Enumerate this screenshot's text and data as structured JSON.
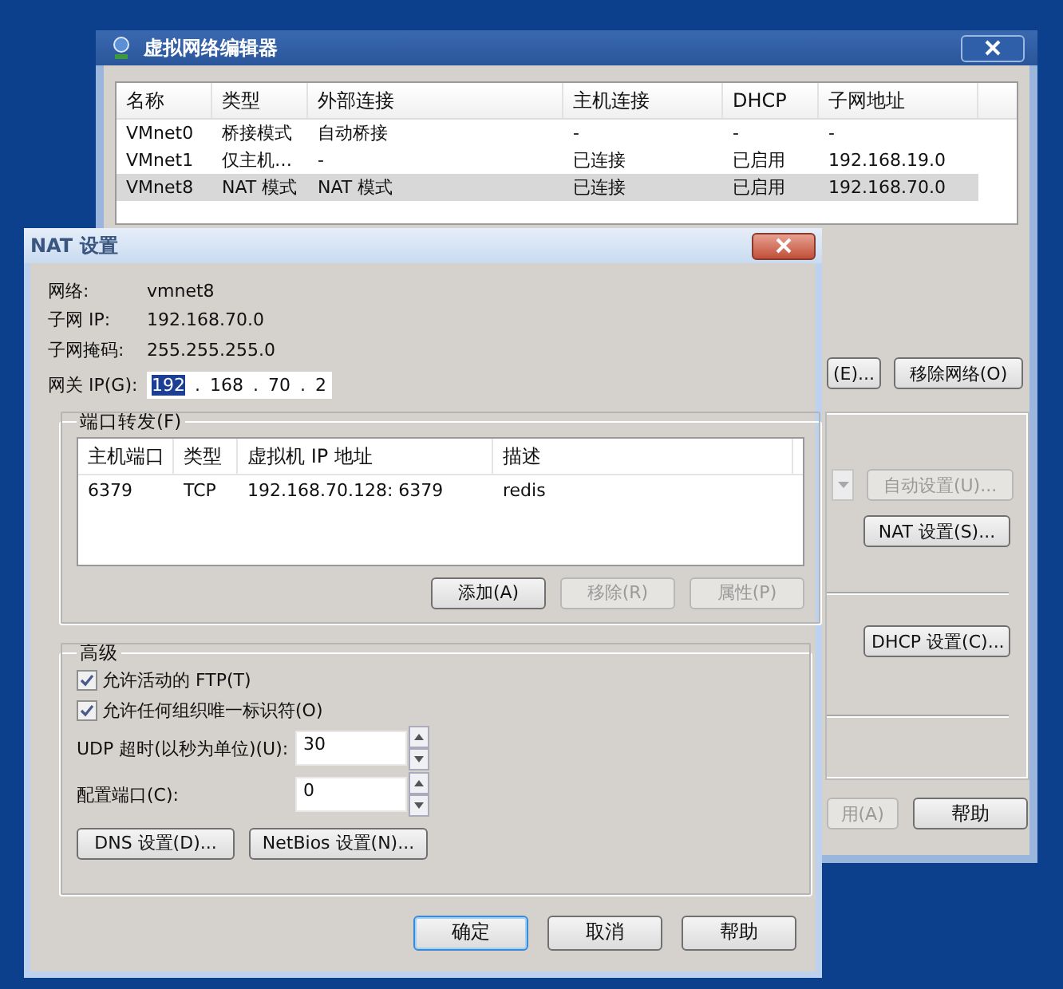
{
  "network_editor": {
    "title": "虚拟网络编辑器",
    "columns": [
      "名称",
      "类型",
      "外部连接",
      "主机连接",
      "DHCP",
      "子网地址"
    ],
    "rows": [
      {
        "cells": [
          "VMnet0",
          "桥接模式",
          "自动桥接",
          "-",
          "-",
          "-"
        ],
        "selected": false
      },
      {
        "cells": [
          "VMnet1",
          "仅主机…",
          "-",
          "已连接",
          "已启用",
          "192.168.19.0"
        ],
        "selected": false
      },
      {
        "cells": [
          "VMnet8",
          "NAT 模式",
          "NAT 模式",
          "已连接",
          "已启用",
          "192.168.70.0"
        ],
        "selected": true
      }
    ],
    "top_buttons": [
      {
        "label": "(E)...",
        "disabled": false
      },
      {
        "label": "移除网络(O)",
        "disabled": false
      }
    ],
    "dropdown": {
      "disabled": true
    },
    "auto_button": {
      "label": "自动设置(U)...",
      "disabled": true
    },
    "nat_button": {
      "label": "NAT 设置(S)...",
      "disabled": false
    },
    "dhcp_button": {
      "label": "DHCP 设置(C)...",
      "disabled": false
    },
    "bottom_buttons": [
      {
        "label": "用(A)",
        "disabled": true
      },
      {
        "label": "帮助",
        "disabled": false
      }
    ]
  },
  "nat_dialog": {
    "title": "NAT 设置",
    "info": [
      {
        "label": "网络:",
        "value": "vmnet8"
      },
      {
        "label": "子网 IP:",
        "value": "192.168.70.0"
      },
      {
        "label": "子网掩码:",
        "value": "255.255.255.0"
      }
    ],
    "gateway": {
      "label": "网关 IP(G):",
      "separator": ".",
      "octets": [
        {
          "text": "192",
          "selected": true
        },
        {
          "text": "168",
          "selected": false
        },
        {
          "text": "70",
          "selected": false
        },
        {
          "text": "2",
          "selected": false
        }
      ]
    },
    "port_forwarding": {
      "title": "端口转发(F)",
      "columns": [
        "主机端口",
        "类型",
        "虚拟机 IP 地址",
        "描述"
      ],
      "rows": [
        {
          "cells": [
            "6379",
            "TCP",
            "192.168.70.128: 6379",
            "redis"
          ]
        }
      ],
      "buttons": [
        {
          "label": "添加(A)",
          "disabled": false
        },
        {
          "label": "移除(R)",
          "disabled": true
        },
        {
          "label": "属性(P)",
          "disabled": true
        }
      ]
    },
    "advanced": {
      "title": "高级",
      "checkboxes": [
        {
          "label": "允许活动的 FTP(T)",
          "checked": true
        },
        {
          "label": "允许任何组织唯一标识符(O)",
          "checked": true
        }
      ],
      "spinners": [
        {
          "label": "UDP 超时(以秒为单位)(U):",
          "value": "30"
        },
        {
          "label": "配置端口(C):",
          "value": "0"
        }
      ],
      "buttons": [
        {
          "label": "DNS 设置(D)...",
          "disabled": false
        },
        {
          "label": "NetBios 设置(N)...",
          "disabled": false
        }
      ]
    },
    "footer_buttons": [
      {
        "label": "确定",
        "default": true,
        "disabled": false
      },
      {
        "label": "取消",
        "default": false,
        "disabled": false
      },
      {
        "label": "帮助",
        "default": false,
        "disabled": false
      }
    ]
  }
}
